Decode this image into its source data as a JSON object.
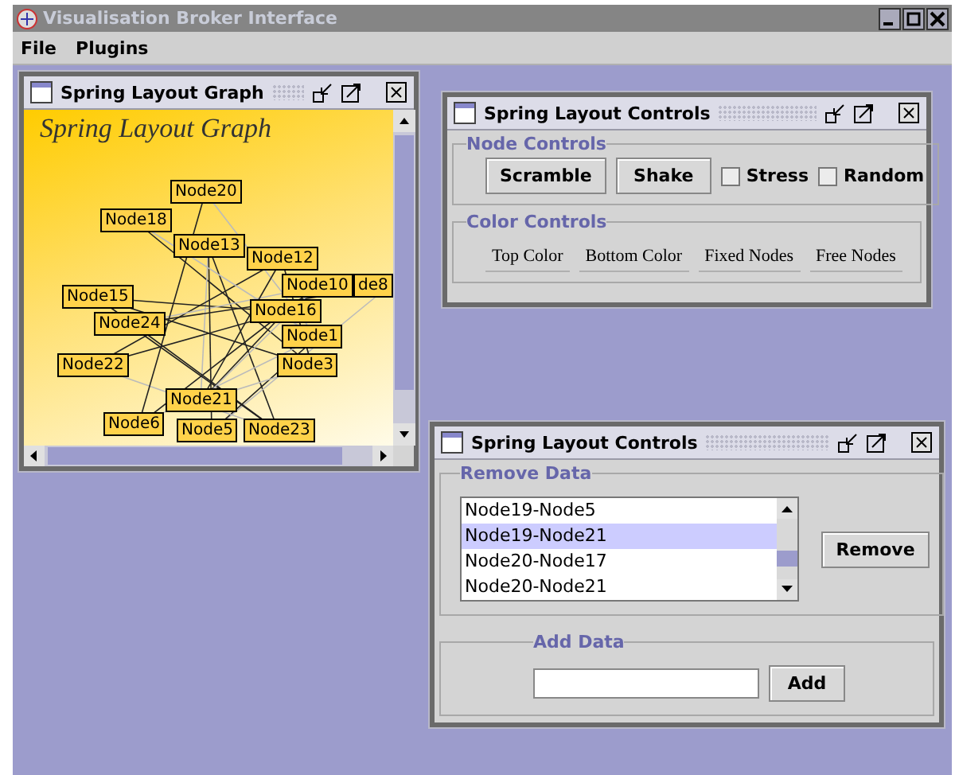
{
  "window": {
    "title": "Visualisation Broker Interface"
  },
  "menu": [
    "File",
    "Plugins"
  ],
  "graph_frame": {
    "title": "Spring Layout Graph",
    "heading": "Spring Layout Graph",
    "nodes": [
      {
        "label": "Node20"
      },
      {
        "label": "Node18"
      },
      {
        "label": "Node13"
      },
      {
        "label": "Node12"
      },
      {
        "label": "Node10"
      },
      {
        "label": "de8"
      },
      {
        "label": "Node16"
      },
      {
        "label": "Node15"
      },
      {
        "label": "Node24"
      },
      {
        "label": "Node1"
      },
      {
        "label": "Node3"
      },
      {
        "label": "Node22"
      },
      {
        "label": "Node21"
      },
      {
        "label": "Node6"
      },
      {
        "label": "Node5"
      },
      {
        "label": "Node23"
      }
    ]
  },
  "controls_frame": {
    "title": "Spring Layout Controls",
    "node_controls": {
      "legend": "Node Controls",
      "buttons": [
        "Scramble",
        "Shake"
      ],
      "checkboxes": [
        {
          "label": "Stress",
          "checked": false
        },
        {
          "label": "Random",
          "checked": false
        }
      ]
    },
    "color_controls": {
      "legend": "Color Controls",
      "buttons": [
        "Top Color",
        "Bottom Color",
        "Fixed Nodes",
        "Free Nodes"
      ]
    }
  },
  "data_frame": {
    "title": "Spring Layout Controls",
    "remove": {
      "legend": "Remove Data",
      "items": [
        {
          "label": "Node19-Node5",
          "selected": false
        },
        {
          "label": "Node19-Node21",
          "selected": true
        },
        {
          "label": "Node20-Node17",
          "selected": false
        },
        {
          "label": "Node20-Node21",
          "selected": false
        }
      ],
      "button": "Remove"
    },
    "add": {
      "legend": "Add Data",
      "button": "Add"
    }
  }
}
